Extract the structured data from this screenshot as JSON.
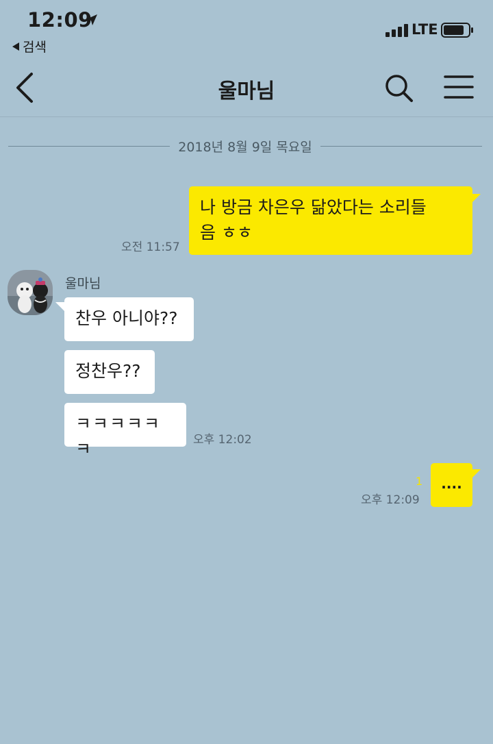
{
  "status_bar": {
    "time": "12:09",
    "back_app_label": "검색",
    "network": "LTE"
  },
  "nav": {
    "title": "울마님"
  },
  "chat": {
    "date_divider": "2018년 8월 9일 목요일",
    "messages": [
      {
        "from": "me",
        "text": "나 방금 차은우 닮았다는 소리들\n음 ㅎㅎ",
        "time": "오전 11:57"
      },
      {
        "from": "them",
        "sender": "울마님",
        "text": "찬우 아니야??"
      },
      {
        "from": "them",
        "text": "정찬우??"
      },
      {
        "from": "them",
        "text": "ㅋㅋㅋㅋㅋㅋ",
        "time": "오후 12:02"
      },
      {
        "from": "me",
        "text": "....",
        "time": "오후 12:09",
        "unread": "1"
      }
    ]
  },
  "colors": {
    "background": "#a9c2d1",
    "my_bubble": "#fbe900",
    "their_bubble": "#ffffff"
  }
}
